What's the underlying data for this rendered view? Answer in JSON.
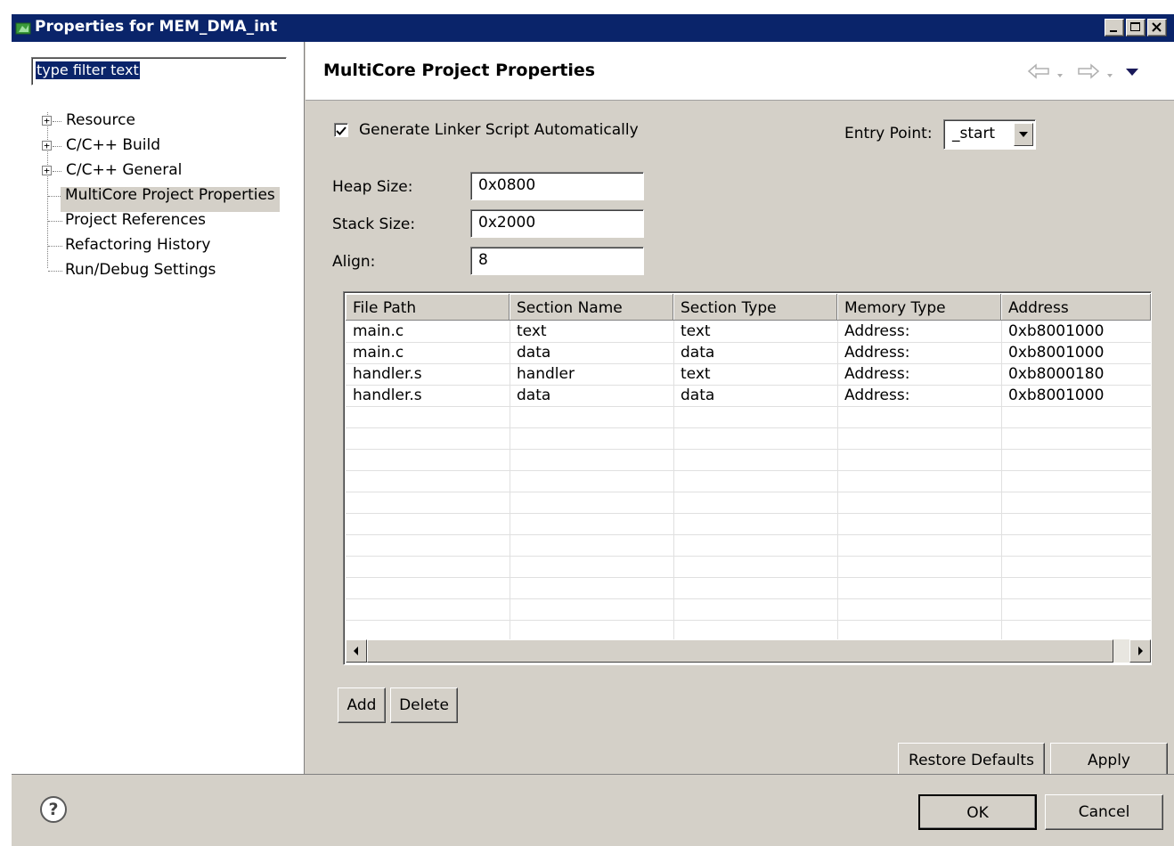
{
  "window": {
    "title": "Properties for MEM_DMA_int"
  },
  "filter": {
    "placeholder": "type filter text"
  },
  "tree": {
    "items": [
      {
        "label": "Resource",
        "expandable": true
      },
      {
        "label": "C/C++ Build",
        "expandable": true
      },
      {
        "label": "C/C++ General",
        "expandable": true
      },
      {
        "label": "MultiCore Project Properties",
        "expandable": false,
        "selected": true
      },
      {
        "label": "Project References",
        "expandable": false
      },
      {
        "label": "Refactoring History",
        "expandable": false
      },
      {
        "label": "Run/Debug Settings",
        "expandable": false
      }
    ]
  },
  "page": {
    "title": "MultiCore Project Properties"
  },
  "form": {
    "generate_linker_label": "Generate Linker Script Automatically",
    "generate_linker_checked": true,
    "entry_point_label": "Entry Point:",
    "entry_point_value": "_start",
    "heap_label": "Heap Size:",
    "heap_value": "0x0800",
    "stack_label": "Stack Size:",
    "stack_value": "0x2000",
    "align_label": "Align:",
    "align_value": "8"
  },
  "table": {
    "columns": [
      "File Path",
      "Section Name",
      "Section Type",
      "Memory Type",
      "Address"
    ],
    "rows": [
      [
        "main.c",
        "text",
        "text",
        "Address:",
        "0xb8001000"
      ],
      [
        "main.c",
        "data",
        "data",
        "Address:",
        "0xb8001000"
      ],
      [
        "handler.s",
        "handler",
        "text",
        "Address:",
        "0xb8000180"
      ],
      [
        "handler.s",
        "data",
        "data",
        "Address:",
        "0xb8001000"
      ]
    ]
  },
  "buttons": {
    "add": "Add",
    "delete": "Delete",
    "restore_defaults": "Restore Defaults",
    "apply": "Apply",
    "ok": "OK",
    "cancel": "Cancel",
    "help": "?"
  },
  "icons": {
    "back": "back-arrow-icon",
    "forward": "forward-arrow-icon",
    "menu": "view-menu-icon"
  },
  "colors": {
    "titlebar": "#0a246a",
    "dialog_bg": "#d4d0c8",
    "selection": "#0a246a"
  }
}
